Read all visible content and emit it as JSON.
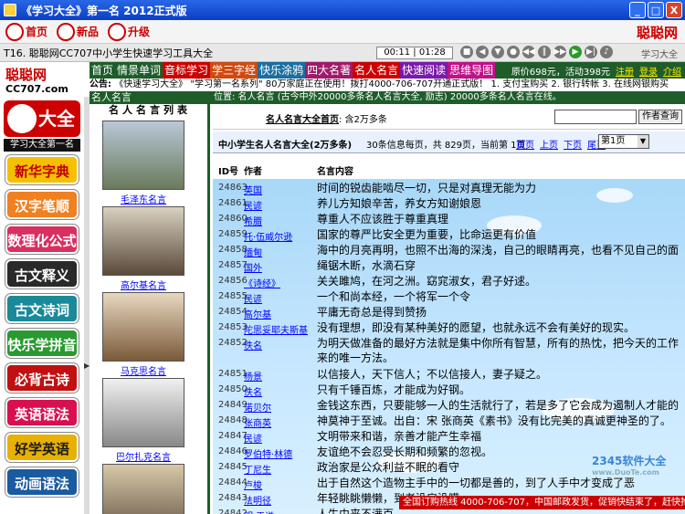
{
  "window": {
    "title": "《学习大全》第一名  2012正式版",
    "buttons": [
      "_",
      "□",
      "X"
    ]
  },
  "top_toolbar": {
    "items": [
      "首页",
      "新品",
      "升级"
    ],
    "brand": "聪聪网"
  },
  "media_bar": {
    "track": "T16. 聪聪网CC707中小学生快速学习工具大全",
    "time": "00:11 | 01:28",
    "right_text": "学习大全"
  },
  "logo": {
    "main": "聪聪网",
    "sub": "CC707.com"
  },
  "menu": {
    "items": [
      "首页",
      "情景单词",
      "音标学习",
      "学三字经",
      "快乐涂鸦",
      "四大名著",
      "名人名言",
      "快速阅读",
      "思维导图"
    ],
    "price_text": "原价698元，活动398元",
    "links": [
      "注册",
      "登录",
      "介绍"
    ]
  },
  "notice": {
    "label": "公告:",
    "text": "《快速学习大全》 \"学习第一名系列\" 80万家庭正在使用！拨打4000-706-707开通正式版！  1. 支付宝购买 2. 银行转帐 3. 在线网银购买"
  },
  "left_nav": {
    "brand": "大全",
    "subtitle": "学习大全第一名",
    "buttons": [
      {
        "label": "新华字典",
        "bg": "#f5c000",
        "fg": "#c00000"
      },
      {
        "label": "汉字笔顺",
        "bg": "#f08020",
        "fg": "#ffffff"
      },
      {
        "label": "数理化公式",
        "bg": "#d83060",
        "fg": "#ffffff"
      },
      {
        "label": "古文释义",
        "bg": "#2a2a2a",
        "fg": "#ffffff"
      },
      {
        "label": "古文诗词",
        "bg": "#1a8a9a",
        "fg": "#ffffff"
      },
      {
        "label": "快乐学拼音",
        "bg": "#2a9a30",
        "fg": "#ffffff"
      },
      {
        "label": "必背古诗",
        "bg": "#c01010",
        "fg": "#ffffff"
      },
      {
        "label": "英语语法",
        "bg": "#d81050",
        "fg": "#ffffff"
      },
      {
        "label": "好学英语",
        "bg": "#e8b000",
        "fg": "#1a1a1a"
      },
      {
        "label": "动画语法",
        "bg": "#1a5aa0",
        "fg": "#ffffff"
      }
    ]
  },
  "portraits": {
    "panel_title": "名人名言",
    "list_title": "名人名言列表",
    "people": [
      "毛泽东名言",
      "高尔基名言",
      "马克思名言",
      "巴尔扎克名言"
    ]
  },
  "top_strip": "位置: 名人名言  (古今中外20000多条名人名言大全, 励志)       20000多条名人名言在线。",
  "search": {
    "prefix": "名人名言大全首页",
    "suffix": ": 含2万多条",
    "button": "作者查询"
  },
  "info": {
    "title": "中小学生名人名言大全(2万多条)",
    "stats": "30条信息每页，共 829页，当前第 1页",
    "links": [
      "首页",
      "上页",
      "下页",
      "尾页"
    ],
    "page_select": "第1页"
  },
  "table": {
    "headers": [
      "ID号",
      "作者",
      "名言内容"
    ],
    "rows": [
      {
        "id": "24863",
        "author": "英国",
        "quote": "时间的锐齿能啮尽一切，只是对真理无能为力"
      },
      {
        "id": "24861",
        "author": "民谚",
        "quote": "养儿方知娘辛苦，养女方知谢娘恩"
      },
      {
        "id": "24860",
        "author": "希腊",
        "quote": "尊重人不应该胜于尊重真理"
      },
      {
        "id": "24859",
        "author": "托·伍威尔逊",
        "quote": "国家的尊严比安全更为重要，比命运更有价值"
      },
      {
        "id": "24858",
        "author": "缅甸",
        "quote": "海中的月亮再明，也照不出海的深浅，自己的眼睛再亮，也看不见自己的面"
      },
      {
        "id": "24857",
        "author": "国外",
        "quote": "绳锯木断，水滴石穿"
      },
      {
        "id": "24856",
        "author": "《诗经》",
        "quote": "关关雎鸠，在河之洲。窈窕淑女，君子好逑。"
      },
      {
        "id": "24855",
        "author": "民谚",
        "quote": "一个和尚本经，一个将军一个令"
      },
      {
        "id": "24854",
        "author": "高尔基",
        "quote": "平庸无奇总是得到赞扬"
      },
      {
        "id": "24853",
        "author": "陀思妥耶夫斯基",
        "quote": "没有理想，即没有某种美好的愿望，也就永远不会有美好的现实。"
      },
      {
        "id": "24852",
        "author": "佚名",
        "quote": "为明天做准备的最好方法就是集中你所有智慧，所有的热忱，把今天的工作来的唯一方法。"
      },
      {
        "id": "24851",
        "author": "杨景",
        "quote": "以信接人，天下信人；不以信接人，妻子疑之。"
      },
      {
        "id": "24850",
        "author": "佚名",
        "quote": "只有千锤百炼，才能成为好钢。"
      },
      {
        "id": "24849",
        "author": "诺贝尔",
        "quote": "金钱这东西，只要能够一人的生活就行了，若是多了它会成为遏制人才能的"
      },
      {
        "id": "24848",
        "author": "张商英",
        "quote": "神莫神于至诚。出自：宋 张商英《素书》没有比完美的真诚更神圣的了。"
      },
      {
        "id": "24847",
        "author": "民谚",
        "quote": "文明带来和谐，亲善才能产生幸福"
      },
      {
        "id": "24846",
        "author": "罗伯特·林德",
        "quote": "友谊绝不会忍受长期和频繁的忽视。"
      },
      {
        "id": "24845",
        "author": "丁尼生",
        "quote": "政治家是公众利益不眠的看守"
      },
      {
        "id": "24844",
        "author": "卢梭",
        "quote": "出于自然这个造物主手中的一切都是善的，到了人手中才变成了恶"
      },
      {
        "id": "24843",
        "author": "法明径",
        "quote": "年轻眺眺懒懒，到老没房没瞒"
      },
      {
        "id": "24842",
        "author": "明·于谦",
        "quote": "人生由来不满百，"
      }
    ]
  },
  "footer_ticker": "全国订购热线 4000-706-707，中国邮政发货，促销快结束了，赶快抢购吧！",
  "watermark": {
    "main": "2345软件大全",
    "sub": "www.DuoTe.com"
  }
}
